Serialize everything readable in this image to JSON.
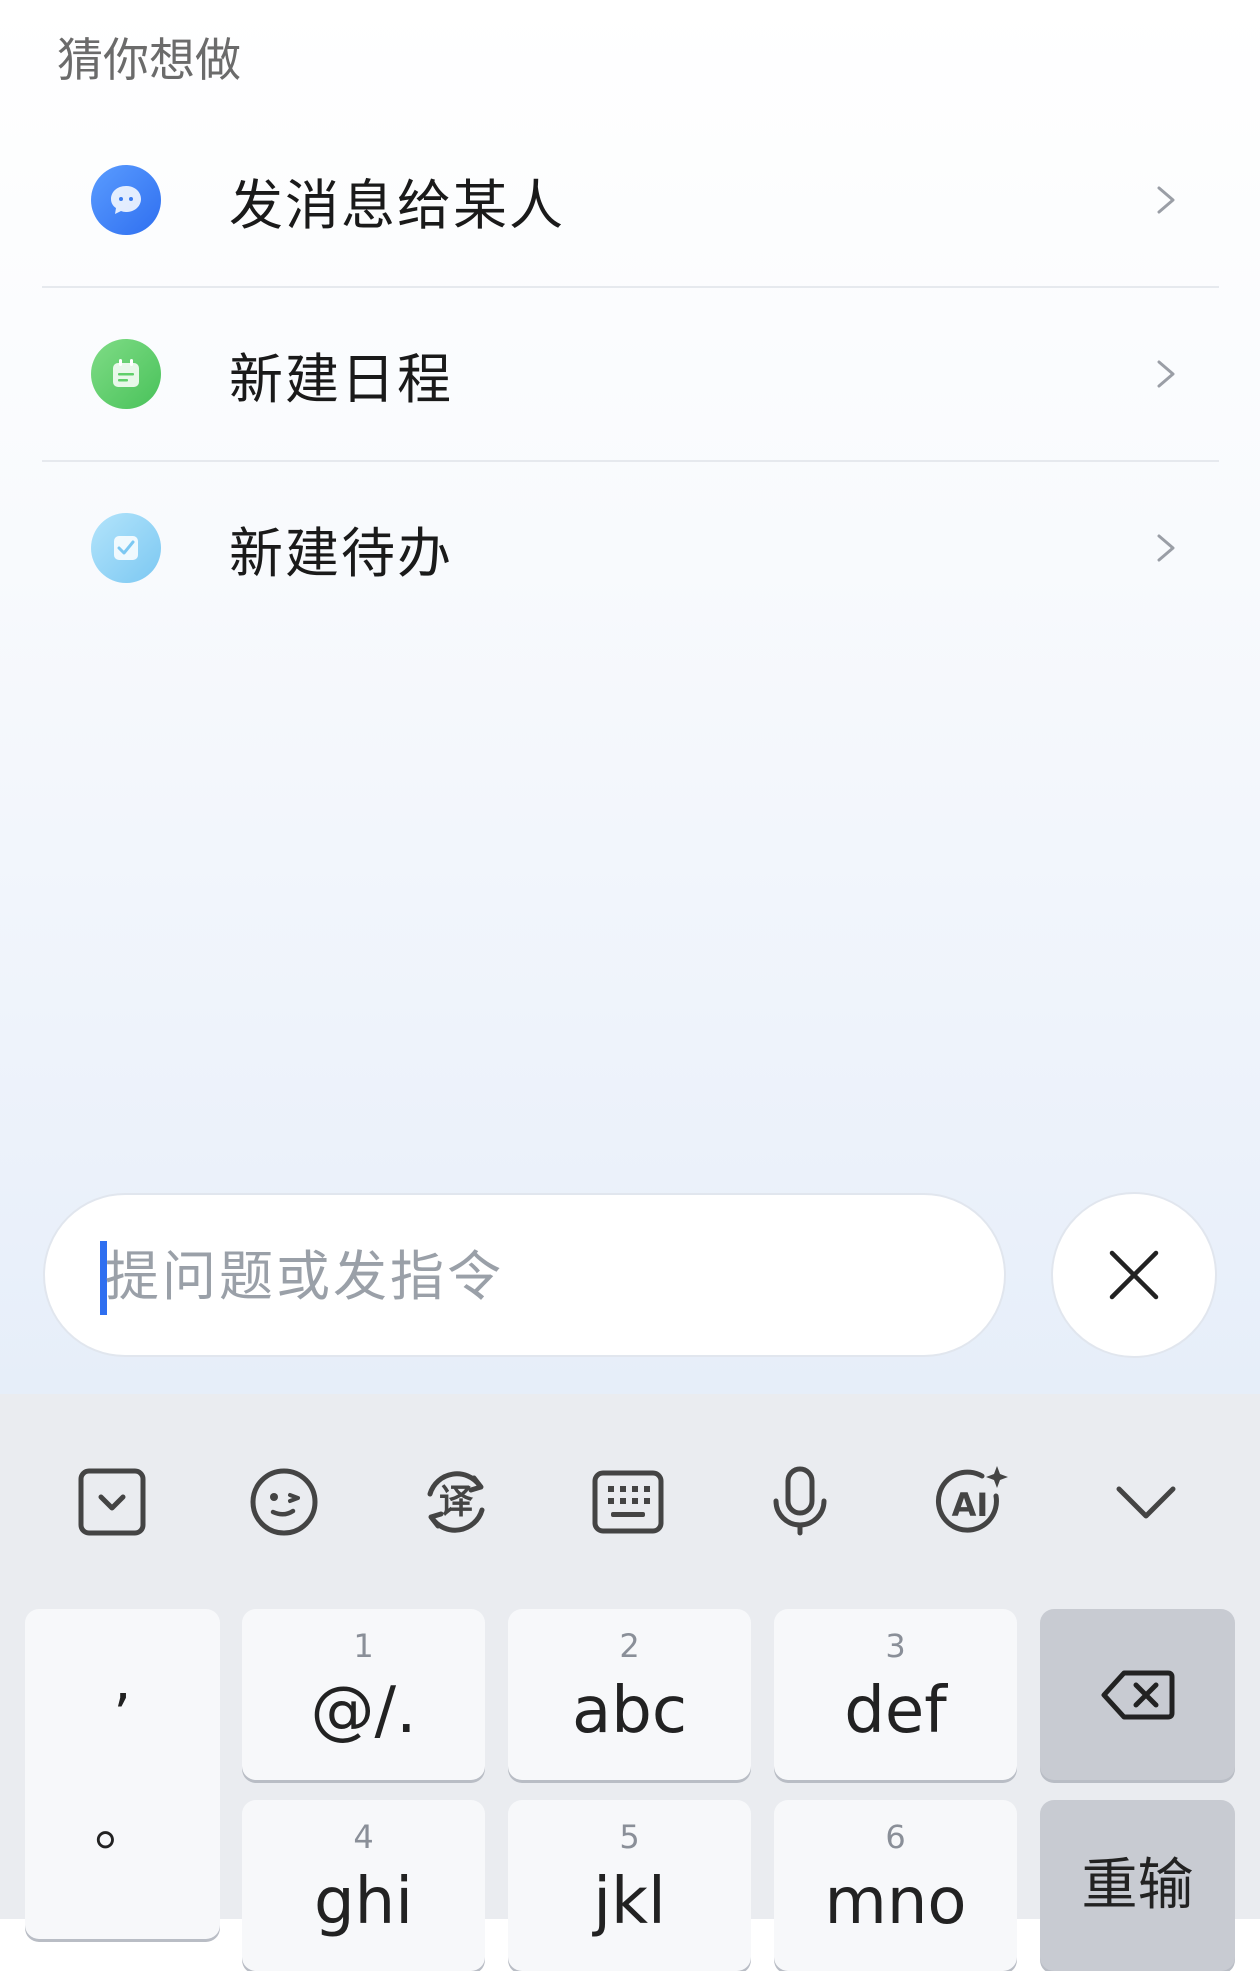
{
  "suggestions": {
    "title": "猜你想做",
    "items": [
      {
        "label": "发消息给某人",
        "icon": "message-bubble-icon",
        "color": "#3a7cf0"
      },
      {
        "label": "新建日程",
        "icon": "calendar-icon",
        "color": "#5fcf6a"
      },
      {
        "label": "新建待办",
        "icon": "todo-check-icon",
        "color": "#8cd0f6"
      }
    ]
  },
  "input": {
    "placeholder": "提问题或发指令"
  },
  "keyboard": {
    "toolbar": [
      "collapse-box-icon",
      "emoji-icon",
      "translate-icon",
      "keyboard-icon",
      "microphone-icon",
      "ai-icon",
      "chevron-down-icon"
    ],
    "translate_label": "译",
    "ai_label": "AI",
    "punct": [
      ",",
      "。"
    ],
    "keys": [
      {
        "num": "1",
        "main": "@/."
      },
      {
        "num": "2",
        "main": "abc"
      },
      {
        "num": "3",
        "main": "def"
      },
      {
        "num": "4",
        "main": "ghi"
      },
      {
        "num": "5",
        "main": "jkl"
      },
      {
        "num": "6",
        "main": "mno"
      }
    ],
    "reset_label": "重输"
  }
}
